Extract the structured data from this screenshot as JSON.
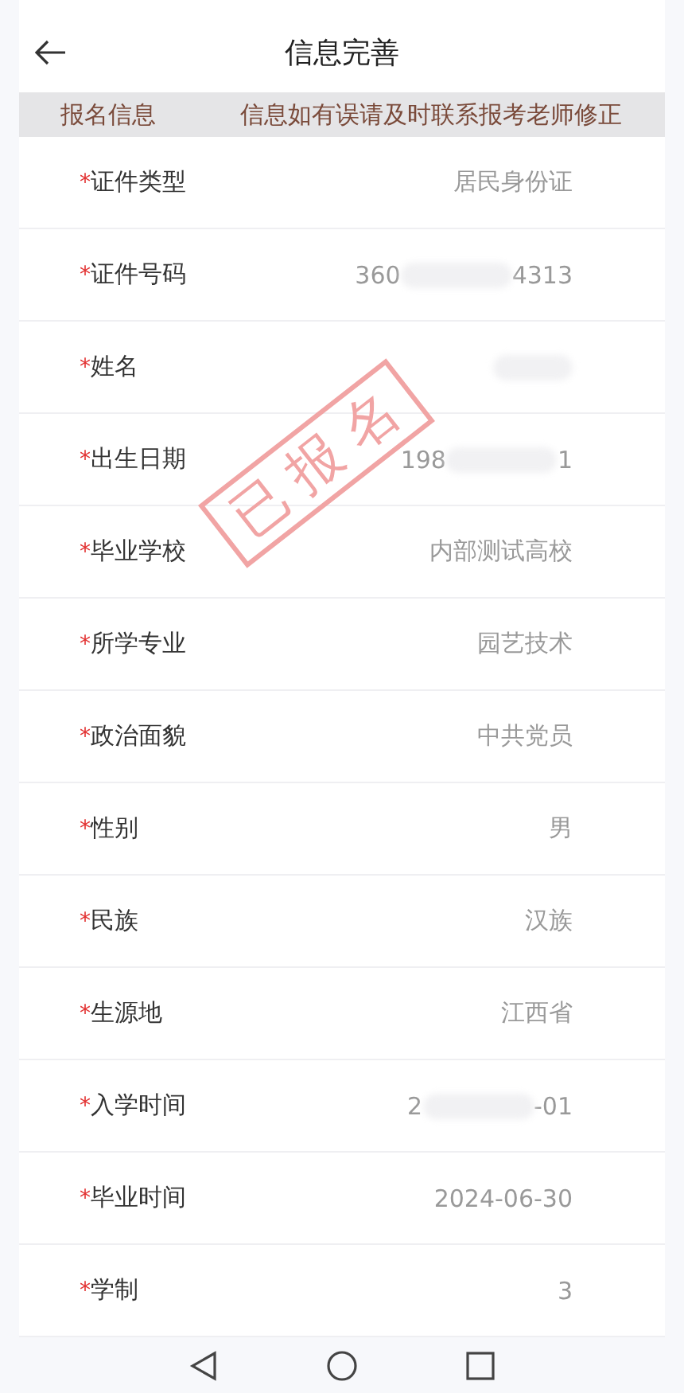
{
  "header": {
    "title": "信息完善"
  },
  "notice": {
    "label": "报名信息",
    "message": "信息如有误请及时联系报考老师修正"
  },
  "stamp": {
    "text": "已报名"
  },
  "rows": [
    {
      "label": "证件类型",
      "marker": "*",
      "kind": "text",
      "value": "居民身份证"
    },
    {
      "label": "证件号码",
      "marker": "*",
      "kind": "masked",
      "parts": [
        "360",
        "4313"
      ]
    },
    {
      "label": "姓名",
      "marker": "*",
      "kind": "hidden"
    },
    {
      "label": "出生日期",
      "marker": "*",
      "kind": "masked",
      "parts": [
        "198",
        "1"
      ]
    },
    {
      "label": "毕业学校",
      "marker": "*",
      "kind": "text",
      "value": "内部测试高校"
    },
    {
      "label": "所学专业",
      "marker": "*",
      "kind": "text",
      "value": "园艺技术"
    },
    {
      "label": "政治面貌",
      "marker": "*",
      "kind": "text",
      "value": "中共党员"
    },
    {
      "label": "性别",
      "marker": "*",
      "kind": "text",
      "value": "男"
    },
    {
      "label": "民族",
      "marker": "*",
      "kind": "text",
      "value": "汉族"
    },
    {
      "label": "生源地",
      "marker": "*",
      "kind": "text",
      "value": "江西省"
    },
    {
      "label": "入学时间",
      "marker": "*",
      "kind": "masked",
      "parts": [
        "2",
        "-01"
      ]
    },
    {
      "label": "毕业时间",
      "marker": "*",
      "kind": "text",
      "value": "2024-06-30"
    },
    {
      "label": "学制",
      "marker": "*",
      "kind": "text",
      "value": "3"
    }
  ]
}
